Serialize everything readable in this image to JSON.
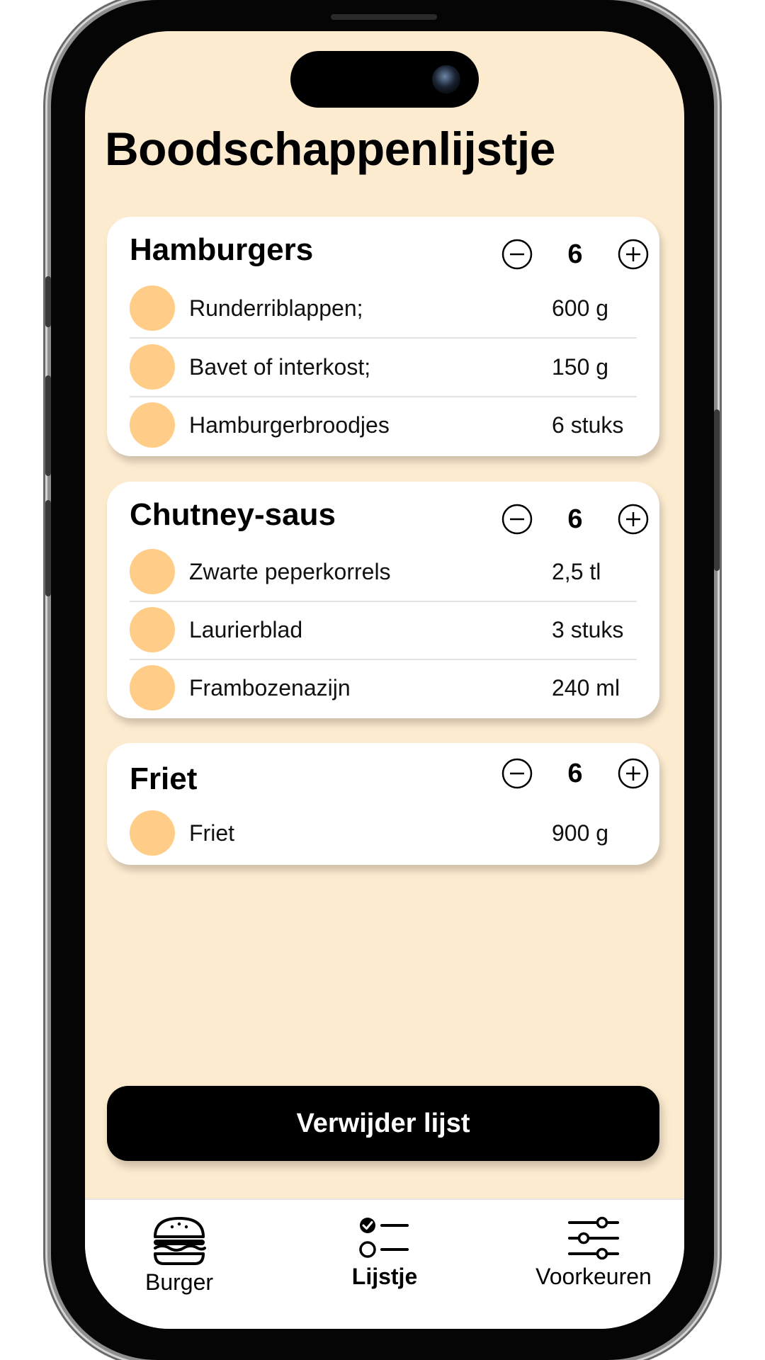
{
  "header": {
    "title": "Boodschappenlijstje"
  },
  "sections": [
    {
      "title": "Hamburgers",
      "count": "6",
      "items": [
        {
          "name": "Runderriblappen;",
          "quantity": "600 g"
        },
        {
          "name": "Bavet of interkost;",
          "quantity": "150 g"
        },
        {
          "name": "Hamburgerbroodjes",
          "quantity": "6 stuks"
        }
      ]
    },
    {
      "title": "Chutney-saus",
      "count": "6",
      "items": [
        {
          "name": "Zwarte peperkorrels",
          "quantity": "2,5 tl"
        },
        {
          "name": "Laurierblad",
          "quantity": "3 stuks"
        },
        {
          "name": "Frambozenazijn",
          "quantity": "240 ml"
        }
      ]
    },
    {
      "title": "Friet",
      "count": "6",
      "items": [
        {
          "name": "Friet",
          "quantity": "900 g"
        }
      ]
    }
  ],
  "actions": {
    "delete_label": "Verwijder lijst"
  },
  "tabbar": {
    "tabs": [
      {
        "label": "Burger",
        "icon": "burger-icon",
        "active": false
      },
      {
        "label": "Lijstje",
        "icon": "checklist-icon",
        "active": true
      },
      {
        "label": "Voorkeuren",
        "icon": "sliders-icon",
        "active": false
      }
    ]
  },
  "colors": {
    "background": "#fdebd0",
    "check_circle": "#ffcd87",
    "card": "#ffffff",
    "button": "#000000"
  },
  "icons": {
    "stepper_minus": "minus-circle-icon",
    "stepper_plus": "plus-circle-icon"
  }
}
